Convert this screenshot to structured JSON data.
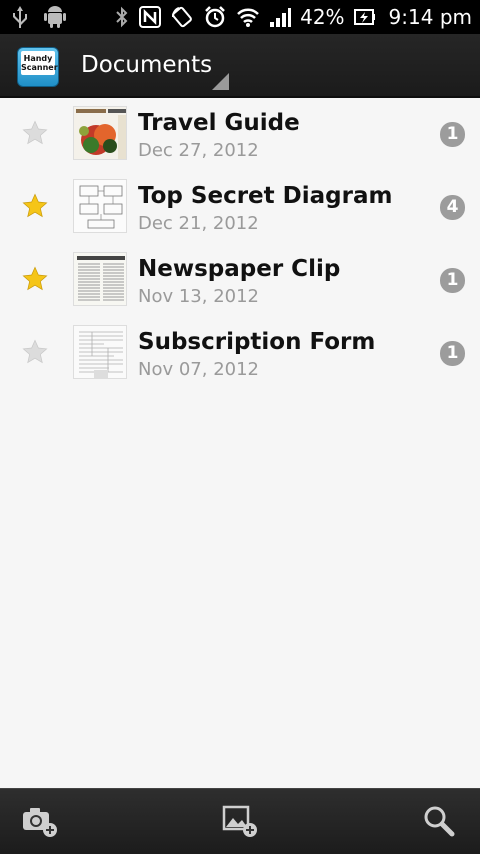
{
  "status_bar": {
    "battery": "42%",
    "time": "9:14 pm"
  },
  "app": {
    "logo_text_line1": "Handy",
    "logo_text_line2": "Scanner",
    "title": "Documents"
  },
  "documents": [
    {
      "title": "Travel Guide",
      "date": "Dec 27, 2012",
      "pages": "1",
      "starred": false
    },
    {
      "title": "Top Secret Diagram",
      "date": "Dec 21, 2012",
      "pages": "4",
      "starred": true
    },
    {
      "title": "Newspaper Clip",
      "date": "Nov 13, 2012",
      "pages": "1",
      "starred": true
    },
    {
      "title": "Subscription Form",
      "date": "Nov 07, 2012",
      "pages": "1",
      "starred": false
    }
  ],
  "colors": {
    "star_on": "#f5c518",
    "star_off": "#dcdcdc",
    "badge": "#9c9c9c"
  },
  "bottom_bar": {
    "icons": [
      "camera-add-icon",
      "image-add-icon",
      "search-icon"
    ]
  }
}
